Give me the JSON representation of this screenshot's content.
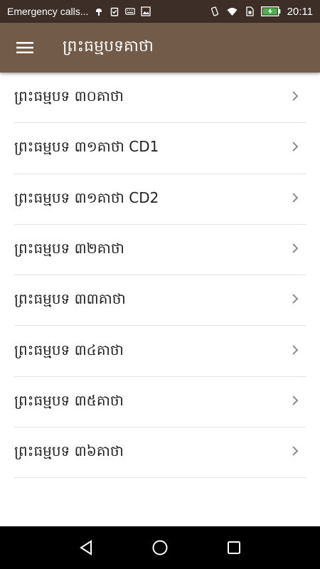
{
  "status_bar": {
    "notification_text": "Emergency calls...",
    "time": "20:11",
    "icons_left": [
      "android-debug-icon",
      "clipboard-icon",
      "keyboard-icon",
      "image-icon"
    ],
    "icons_right": [
      "vibrate-icon",
      "wifi-icon",
      "sim-icon",
      "battery-charging-icon"
    ],
    "battery_color": "#4caf50"
  },
  "app_bar": {
    "title": "ព្រះធម្មបទគាថា",
    "background_color": "#735b49",
    "menu_icon": "hamburger-menu-icon"
  },
  "list": {
    "items": [
      {
        "label": "ព្រះធម្មបទ ៣០គាថា"
      },
      {
        "label": "ព្រះធម្មបទ ៣១គាថា CD1"
      },
      {
        "label": "ព្រះធម្មបទ ៣១គាថា CD2"
      },
      {
        "label": "ព្រះធម្មបទ ៣២គាថា"
      },
      {
        "label": "ព្រះធម្មបទ ៣៣គាថា"
      },
      {
        "label": "ព្រះធម្មបទ ៣៤គាថា"
      },
      {
        "label": "ព្រះធម្មបទ ៣៥គាថា"
      },
      {
        "label": "ព្រះធម្មបទ ៣៦គាថា"
      }
    ],
    "item_icon": "chevron-right-icon"
  },
  "nav_bar": {
    "buttons": [
      "back-icon",
      "home-icon",
      "recents-icon"
    ]
  }
}
